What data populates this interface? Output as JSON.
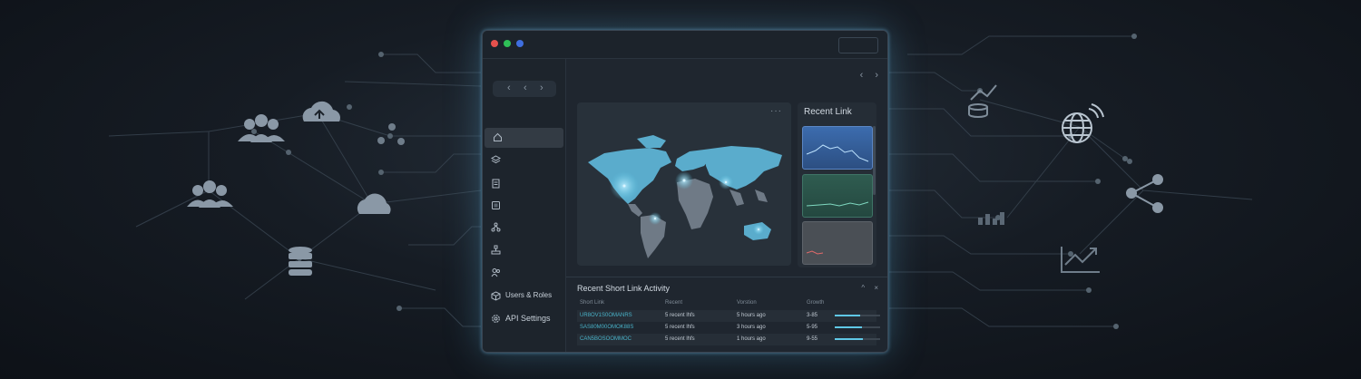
{
  "window": {
    "titlebar": {
      "dot_colors": [
        "#e5514d",
        "#2fbf57",
        "#3f6fe0"
      ]
    },
    "top_nav": {
      "prev": "‹",
      "next": "›"
    }
  },
  "sidebar": {
    "nav_pill": {
      "left": "‹",
      "back": "‹",
      "next": "›"
    },
    "items": [
      {
        "icon": "home-icon",
        "label": ""
      },
      {
        "icon": "layers-icon",
        "label": ""
      },
      {
        "icon": "document-icon",
        "label": ""
      },
      {
        "icon": "grid-icon",
        "label": ""
      },
      {
        "icon": "network-icon",
        "label": ""
      },
      {
        "icon": "hierarchy-icon",
        "label": ""
      },
      {
        "icon": "users-icon",
        "label": ""
      },
      {
        "icon": "cube-icon",
        "label": "Users & Roles"
      },
      {
        "icon": "gear-icon",
        "label": "API Settings"
      }
    ]
  },
  "map_panel": {
    "menu": "···"
  },
  "recent_link": {
    "title": "Recent Link",
    "cards": [
      {
        "color": "#3a67a8"
      },
      {
        "color": "#2f5a4e"
      },
      {
        "color": "#4a4f55"
      }
    ]
  },
  "activity": {
    "title": "Recent Short Link Activity",
    "controls": {
      "collapse": "^",
      "close": "×"
    },
    "columns": [
      "Short Link",
      "Recent",
      "Vorstion",
      "Growth"
    ],
    "rows": [
      {
        "link": "UR8OV1S0OMANRS",
        "recent": "5 recent lhfs",
        "time": "5 hours ago",
        "growth_label": "3-85",
        "growth": 0.55
      },
      {
        "link": "SAS80M00OMOK88S",
        "recent": "5 recent lhfs",
        "time": "3 hours ago",
        "growth_label": "5-95",
        "growth": 0.6
      },
      {
        "link": "CAN5BOSOOMMOC",
        "recent": "5 recent lhfs",
        "time": "1 hours ago",
        "growth_label": "9-55",
        "growth": 0.62
      }
    ]
  }
}
